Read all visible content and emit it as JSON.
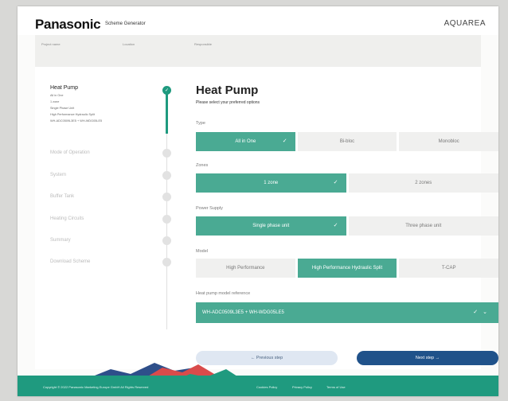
{
  "header": {
    "logo": "Panasonic",
    "app_name": "Scheme Generator",
    "brand": "AQUAREA"
  },
  "subbar": {
    "fields": [
      "Project name",
      "Location",
      "Responsible"
    ]
  },
  "sidebar": {
    "active": {
      "title": "Heat Pump",
      "details": [
        "All in One",
        "1 zone",
        "Single Phase Unit",
        "High Performance Hydraulic Split",
        "WH-ADC0509L3E5 + WH-WDG05LE5"
      ]
    },
    "steps": [
      "Mode of Operation",
      "System",
      "Buffer Tank",
      "Heating Circuits",
      "Summary",
      "Download Scheme"
    ]
  },
  "main": {
    "title": "Heat Pump",
    "lead": "Please select your preferred options",
    "type": {
      "label": "Type",
      "options": [
        "All in One",
        "Bi-bloc",
        "Monobloc"
      ]
    },
    "zones": {
      "label": "Zones",
      "options": [
        "1 zone",
        "2 zones"
      ]
    },
    "power": {
      "label": "Power Supply",
      "options": [
        "Single phase unit",
        "Three phase unit"
      ]
    },
    "model": {
      "label": "Model",
      "options": [
        "High Performance",
        "High Performance Hydraulic Split",
        "T-CAP"
      ]
    },
    "reference": {
      "label": "Heat pump model reference",
      "value": "WH-ADC0509L3E5 + WH-WDG05LE5"
    }
  },
  "buttons": {
    "prev": "← Previous step",
    "next": "Next step →"
  },
  "footer": {
    "copyright": "Copyright © 2022 Panasonic Marketing Europe GmbH All Rights Reserved",
    "links": [
      "Cookies Policy",
      "Privacy Policy",
      "Terms of Use"
    ]
  },
  "colors": {
    "accent": "#4aaa93",
    "accent_dark": "#1f9a7f",
    "primary_button": "#20528a"
  },
  "icons": {
    "check": "check-icon",
    "chevron": "chevron-down-icon"
  }
}
